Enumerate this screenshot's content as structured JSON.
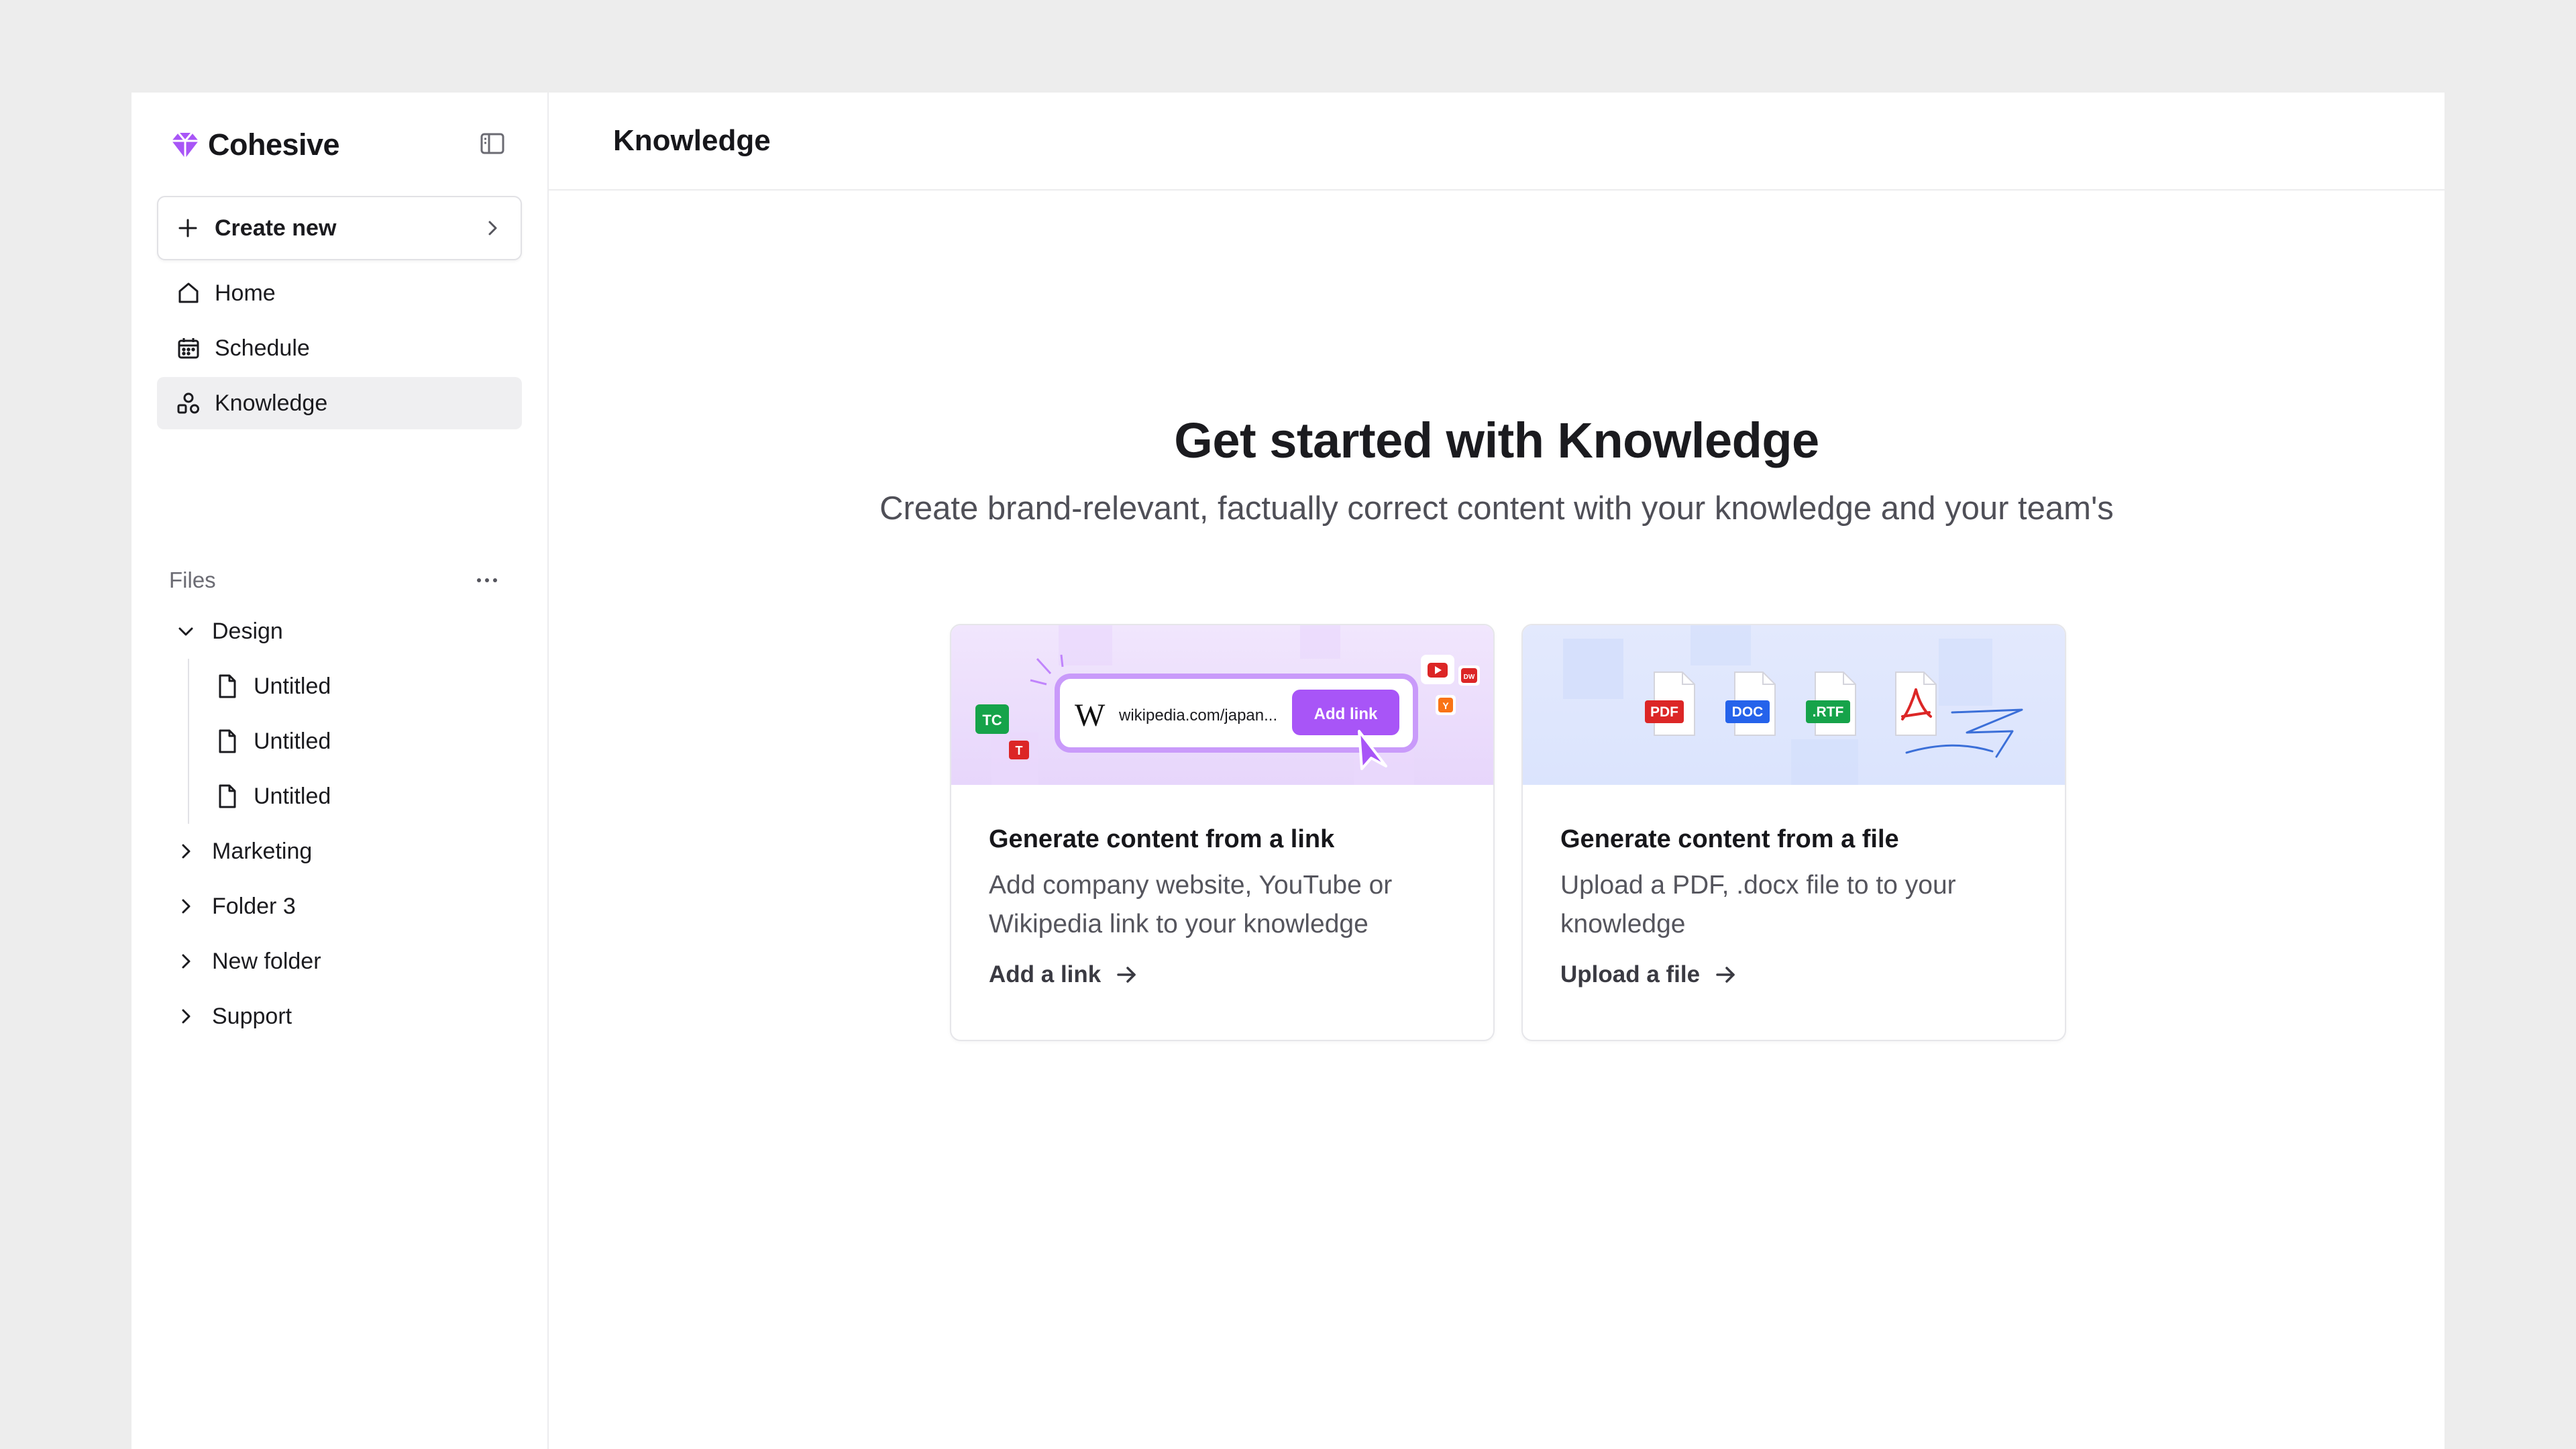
{
  "brand": {
    "name": "Cohesive",
    "accent": "#a855f7"
  },
  "sidebar": {
    "create_label": "Create new",
    "nav": [
      {
        "label": "Home",
        "icon": "home-icon"
      },
      {
        "label": "Schedule",
        "icon": "calendar-icon"
      },
      {
        "label": "Knowledge",
        "icon": "knowledge-icon",
        "active": true
      }
    ],
    "files_label": "Files",
    "tree": {
      "design": {
        "label": "Design",
        "children": [
          {
            "label": "Untitled"
          },
          {
            "label": "Untitled"
          },
          {
            "label": "Untitled"
          }
        ]
      },
      "folders": [
        {
          "label": "Marketing"
        },
        {
          "label": "Folder 3"
        },
        {
          "label": "New folder"
        },
        {
          "label": "Support"
        }
      ]
    }
  },
  "header": {
    "title": "Knowledge"
  },
  "hero": {
    "title": "Get started with Knowledge",
    "subtitle": "Create brand-relevant, factually correct content with your knowledge and your team's"
  },
  "cards": [
    {
      "title": "Generate content from a link",
      "description": "Add company website, YouTube or Wikipedia link to your knowledge",
      "action": "Add a link",
      "illustration": {
        "url_text": "wikipedia.com/japan...",
        "button_text": "Add link",
        "wiki_glyph": "W",
        "badges": [
          "TC",
          "T",
          "DW",
          "Y"
        ]
      }
    },
    {
      "title": "Generate content from a file",
      "description": "Upload a PDF, .docx file to to your knowledge",
      "action": "Upload a file",
      "illustration": {
        "file_types": [
          {
            "label": "PDF",
            "color": "#dc2626"
          },
          {
            "label": "DOC",
            "color": "#2563eb"
          },
          {
            "label": ".RTF",
            "color": "#16a34a"
          }
        ]
      }
    }
  ]
}
